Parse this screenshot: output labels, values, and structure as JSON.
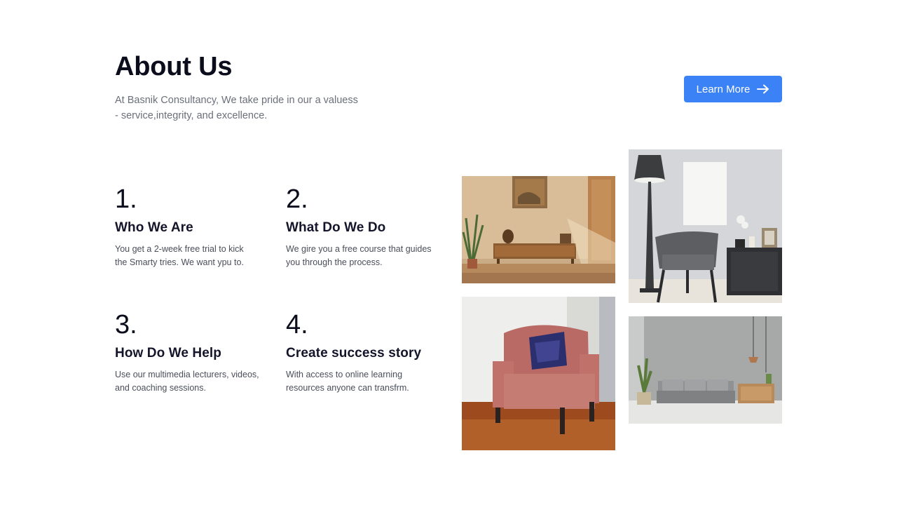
{
  "header": {
    "title": "About Us",
    "subtitle_line1": "At Basnik Consultancy, We take pride in our a valuess",
    "subtitle_line2": "- service,integrity, and excellence.",
    "button_label": "Learn More",
    "button_color": "#3b82f6",
    "button_icon": "arrow-right-icon"
  },
  "features": [
    {
      "number": "1.",
      "title": "Who We Are",
      "desc_line1": "You get a 2-week free trial to kick",
      "desc_line2": "the Smarty tries. We want ypu to."
    },
    {
      "number": "2.",
      "title": "What Do We Do",
      "desc_line1": "We gire you a free course that guides",
      "desc_line2": "you through the process."
    },
    {
      "number": "3.",
      "title": "How Do We Help",
      "desc_line1": "Use our multimedia lecturers, videos,",
      "desc_line2": "and coaching sessions."
    },
    {
      "number": "4.",
      "title": "Create success story",
      "desc_line1": "With access to online learning",
      "desc_line2": "resources anyone can transfrm."
    }
  ],
  "gallery": [
    {
      "subject": "living-room-wooden-console-photo"
    },
    {
      "subject": "grey-armchair-floor-lamp-photo"
    },
    {
      "subject": "pink-armchair-blue-pillow-photo"
    },
    {
      "subject": "grey-sofa-living-room-photo"
    }
  ]
}
